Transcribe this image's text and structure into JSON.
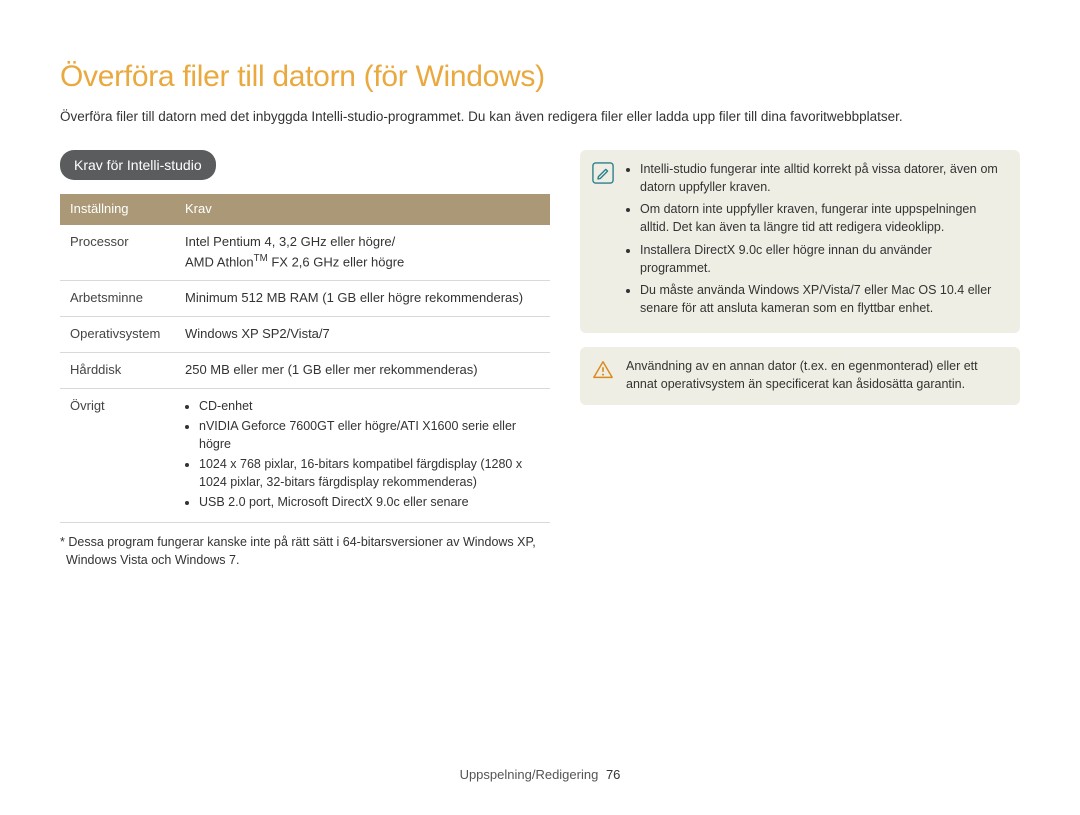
{
  "title": "Överföra filer till datorn (för Windows)",
  "intro": "Överföra filer till datorn med det inbyggda Intelli-studio-programmet. Du kan även redigera filer eller ladda upp filer till dina favoritwebbplatser.",
  "section_heading": "Krav för Intelli-studio",
  "table": {
    "headers": {
      "col1": "Inställning",
      "col2": "Krav"
    },
    "rows": {
      "processor": {
        "label": "Processor",
        "line1": "Intel Pentium 4, 3,2 GHz eller högre/",
        "line2a": "AMD Athlon",
        "line2sup": "TM",
        "line2b": " FX 2,6 GHz eller högre"
      },
      "ram": {
        "label": "Arbetsminne",
        "value": "Minimum 512 MB RAM (1 GB eller högre rekommenderas)"
      },
      "os": {
        "label": "Operativsystem",
        "value": "Windows XP SP2/Vista/7"
      },
      "hdd": {
        "label": "Hårddisk",
        "value": "250 MB eller mer (1 GB eller mer rekommenderas)"
      },
      "other": {
        "label": "Övrigt",
        "items": [
          "CD-enhet",
          "nVIDIA Geforce 7600GT eller högre/ATI X1600 serie eller högre",
          "1024 x 768 pixlar, 16-bitars kompatibel färgdisplay (1280 x 1024 pixlar, 32-bitars färgdisplay rekommenderas)",
          "USB 2.0 port, Microsoft DirectX 9.0c eller senare"
        ]
      }
    }
  },
  "footnote": "* Dessa program fungerar kanske inte på rätt sätt i 64-bitarsversioner av Windows XP, Windows Vista och Windows 7.",
  "note": {
    "items": [
      "Intelli-studio fungerar inte alltid korrekt på vissa datorer, även om datorn uppfyller kraven.",
      "Om datorn inte uppfyller kraven, fungerar inte uppspelningen alltid. Det kan även ta längre tid att redigera videoklipp.",
      "Installera DirectX 9.0c eller högre innan du använder programmet.",
      "Du måste använda Windows XP/Vista/7 eller Mac OS 10.4 eller senare för att ansluta kameran som en flyttbar enhet."
    ]
  },
  "warning": {
    "text": "Användning av en annan dator (t.ex. en egenmonterad) eller ett annat operativsystem än specificerat kan åsidosätta garantin."
  },
  "footer": {
    "section": "Uppspelning/Redigering",
    "page": "76"
  }
}
